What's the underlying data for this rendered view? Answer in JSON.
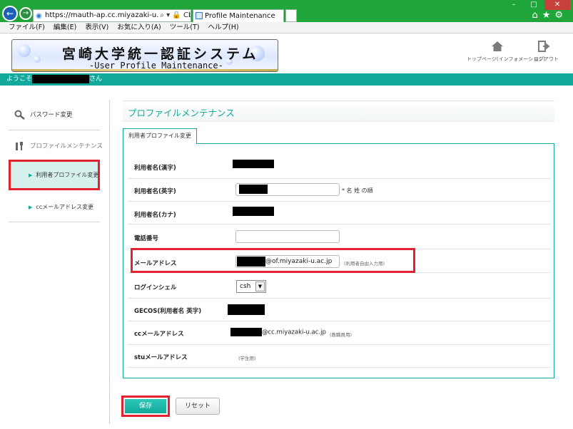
{
  "browser": {
    "url": "https://mauth-ap.cc.miyazaki-u.ac.jp/webr",
    "address_controls": "⌕ ▾ 🔒 C",
    "tab_title": "Profile Maintenance",
    "menu": [
      "ファイル(F)",
      "編集(E)",
      "表示(V)",
      "お気に入り(A)",
      "ツール(T)",
      "ヘルプ(H)"
    ],
    "window_buttons": [
      "–",
      "□",
      "✕"
    ],
    "toolbar_icons": "⌂★⚙"
  },
  "header": {
    "title": "宮崎大学統一認証システム",
    "subtitle": "-User Profile Maintenance-",
    "home_label": "トップページ(インフォメーション)",
    "logout_label": "ログアウト",
    "welcome_prefix": "ようこそ",
    "welcome_suffix": "さん"
  },
  "sidebar": {
    "password": "パスワード変更",
    "profile": "プロファイルメンテナンス",
    "user_profile": "利用者プロファイル変更",
    "cc_email": "ccメールアドレス変更"
  },
  "main": {
    "page_title": "プロファイルメンテナンス",
    "form_tab": "利用者プロファイル変更",
    "fields": {
      "name_kanji_label": "利用者名(漢字)",
      "name_english_label": "利用者名(英字)",
      "name_english_note": "* 名 姓 の順",
      "name_kana_label": "利用者名(カナ)",
      "phone_label": "電話番号",
      "email_label": "メールアドレス",
      "email_domain": "@of.miyazaki-u.ac.jp",
      "email_note": "(利用者自由入力用)",
      "shell_label": "ログインシェル",
      "shell_value": "csh",
      "gecos_label": "GECOS(利用者名 英字)",
      "cc_label": "ccメールアドレス",
      "cc_domain": "@cc.miyazaki-u.ac.jp",
      "cc_note": "(教職員用)",
      "stu_label": "stuメールアドレス",
      "stu_note": "(学生用)"
    },
    "save_button": "保存",
    "reset_button": "リセット"
  },
  "colors": {
    "accent": "#12a89c",
    "highlight": "#e2222e",
    "chrome": "#1fa53a"
  }
}
